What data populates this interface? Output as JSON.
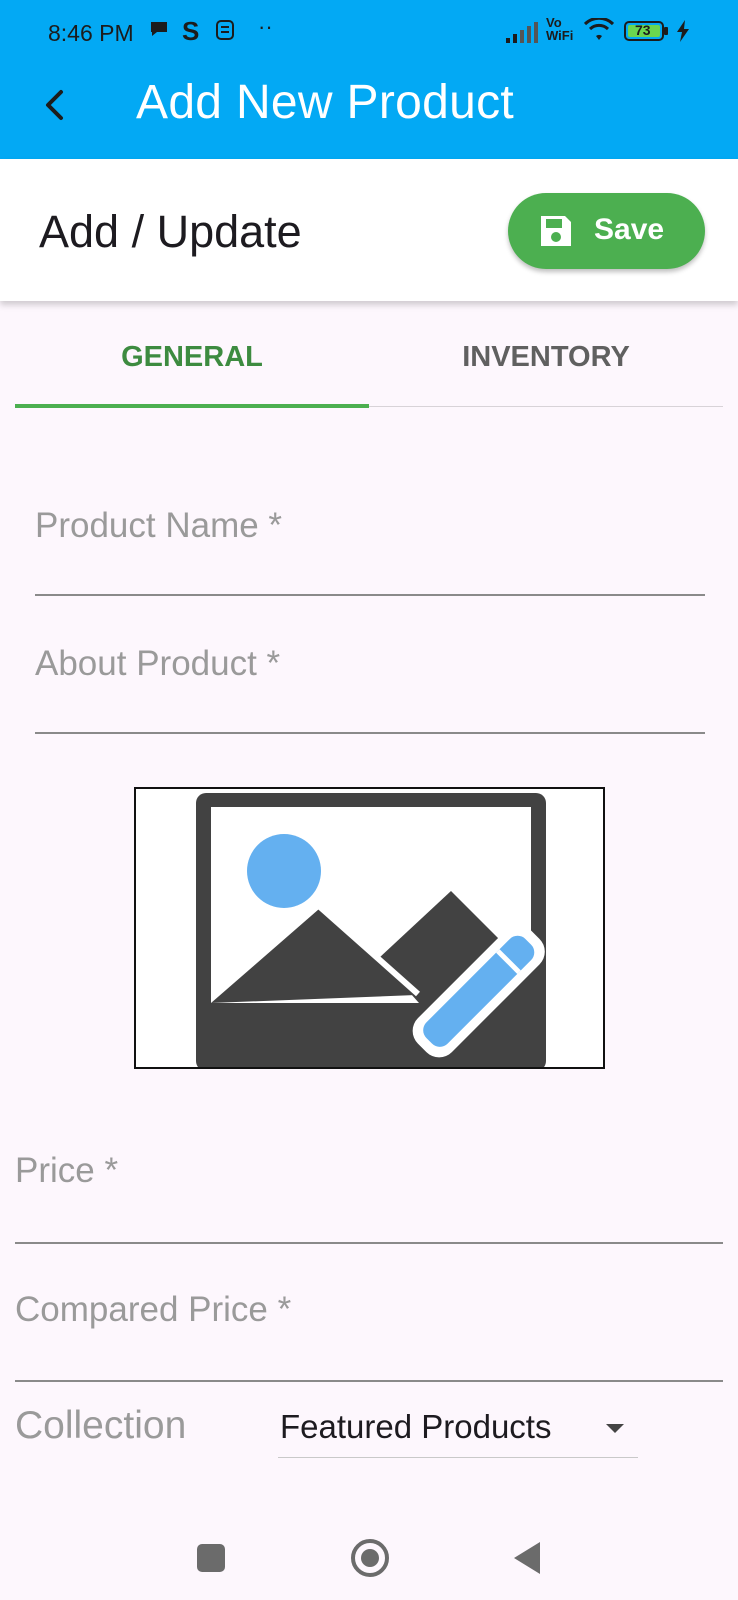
{
  "status_bar": {
    "time": "8:46 PM",
    "icons": [
      "chat-bubble-icon",
      "s-app-icon",
      "notification-icon",
      "more-dots-icon",
      "signal-icon",
      "vowifi-icon",
      "wifi-icon",
      "battery-icon",
      "charging-icon"
    ],
    "vowifi_top": "Vo",
    "vowifi_bottom": "WiFi",
    "battery_level": "73"
  },
  "app_bar": {
    "title": "Add New Product",
    "back_icon": "back-chevron-icon"
  },
  "header": {
    "title": "Add / Update",
    "save_label": "Save",
    "save_icon": "floppy-disk-icon"
  },
  "tabs": [
    {
      "label": "GENERAL",
      "active": true
    },
    {
      "label": "INVENTORY",
      "active": false
    }
  ],
  "form": {
    "product_name": {
      "label": "Product Name *",
      "value": ""
    },
    "about_product": {
      "label": "About Product *",
      "value": ""
    },
    "image_picker_icon": "edit-image-icon",
    "price": {
      "label": "Price *",
      "value": ""
    },
    "compared_price": {
      "label": "Compared Price *",
      "value": ""
    },
    "collection": {
      "label": "Collection",
      "selected": "Featured Products"
    }
  },
  "nav_bar": {
    "icons": [
      "square-recents-icon",
      "circle-home-icon",
      "triangle-back-icon"
    ]
  },
  "colors": {
    "app_bar": "#03a9f4",
    "save_button": "#4caf50",
    "tab_active": "#3d8b40",
    "image_accent": "#64b0f0",
    "image_dark": "#424242"
  }
}
